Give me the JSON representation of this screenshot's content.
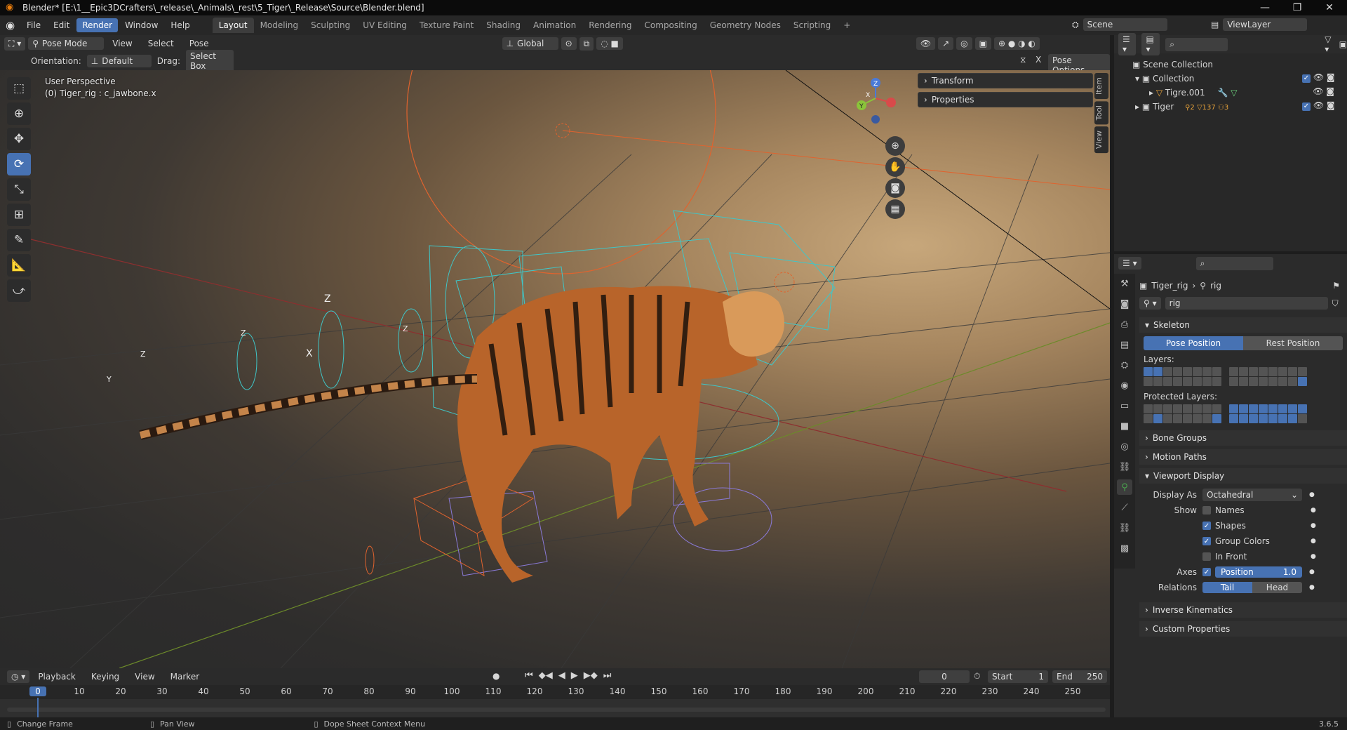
{
  "titlebar": {
    "title": "Blender* [E:\\1__Epic3DCrafters\\_release\\_Animals\\_rest\\5_Tiger\\_Release\\Source\\Blender.blend]"
  },
  "menu": [
    "File",
    "Edit",
    "Render",
    "Window",
    "Help"
  ],
  "workspaces": [
    "Layout",
    "Modeling",
    "Sculpting",
    "UV Editing",
    "Texture Paint",
    "Shading",
    "Animation",
    "Rendering",
    "Compositing",
    "Geometry Nodes",
    "Scripting"
  ],
  "scene": {
    "name": "Scene",
    "viewlayer": "ViewLayer"
  },
  "viewport_header": {
    "mode": "Pose Mode",
    "menus": [
      "View",
      "Select",
      "Pose"
    ],
    "transform": "Global"
  },
  "viewport_sub": {
    "orientation_label": "Orientation:",
    "orientation_value": "Default",
    "drag_label": "Drag:",
    "drag_value": "Select Box",
    "pose_options": "Pose Options",
    "x_label": "X"
  },
  "viewport": {
    "perspective": "User Perspective",
    "active": "(0) Tiger_rig : c_jawbone.x"
  },
  "npanel": {
    "transform": "Transform",
    "properties": "Properties",
    "tabs": [
      "Item",
      "Tool",
      "View"
    ]
  },
  "gizmo": {
    "x": "X",
    "y": "Y",
    "z": "Z"
  },
  "outliner": {
    "root": "Scene Collection",
    "items": [
      {
        "name": "Collection"
      },
      {
        "name": "Tigre.001"
      },
      {
        "name": "Tiger",
        "badges": [
          "2",
          "137",
          "3"
        ]
      }
    ]
  },
  "properties": {
    "breadcrumb_object": "Tiger_rig",
    "breadcrumb_data": "rig",
    "data_name": "rig",
    "skeleton": "Skeleton",
    "pose_position": "Pose Position",
    "rest_position": "Rest Position",
    "layers": "Layers:",
    "protected_layers": "Protected Layers:",
    "bone_groups": "Bone Groups",
    "motion_paths": "Motion Paths",
    "viewport_display": "Viewport Display",
    "display_as_label": "Display As",
    "display_as_value": "Octahedral",
    "show_label": "Show",
    "names": "Names",
    "shapes": "Shapes",
    "group_colors": "Group Colors",
    "in_front": "In Front",
    "axes_label": "Axes",
    "axes_position": "Position",
    "axes_value": "1.0",
    "relations_label": "Relations",
    "tail": "Tail",
    "head": "Head",
    "inverse_kinematics": "Inverse Kinematics",
    "custom_properties": "Custom Properties"
  },
  "timeline": {
    "menus": [
      "Playback",
      "Keying",
      "View",
      "Marker"
    ],
    "current_frame": "0",
    "start_label": "Start",
    "start": "1",
    "end_label": "End",
    "end": "250",
    "ticks": [
      "0",
      "10",
      "20",
      "30",
      "40",
      "50",
      "60",
      "70",
      "80",
      "90",
      "100",
      "110",
      "120",
      "130",
      "140",
      "150",
      "160",
      "170",
      "180",
      "190",
      "200",
      "210",
      "220",
      "230",
      "240",
      "250"
    ]
  },
  "statusbar": {
    "change_frame": "Change Frame",
    "pan_view": "Pan View",
    "context_menu": "Dope Sheet Context Menu",
    "version": "3.6.5"
  },
  "colors": {
    "accent": "#4772b3",
    "orange": "#e87d0d",
    "rig_cyan": "#3fc6c8",
    "rig_orange": "#e0632e"
  }
}
